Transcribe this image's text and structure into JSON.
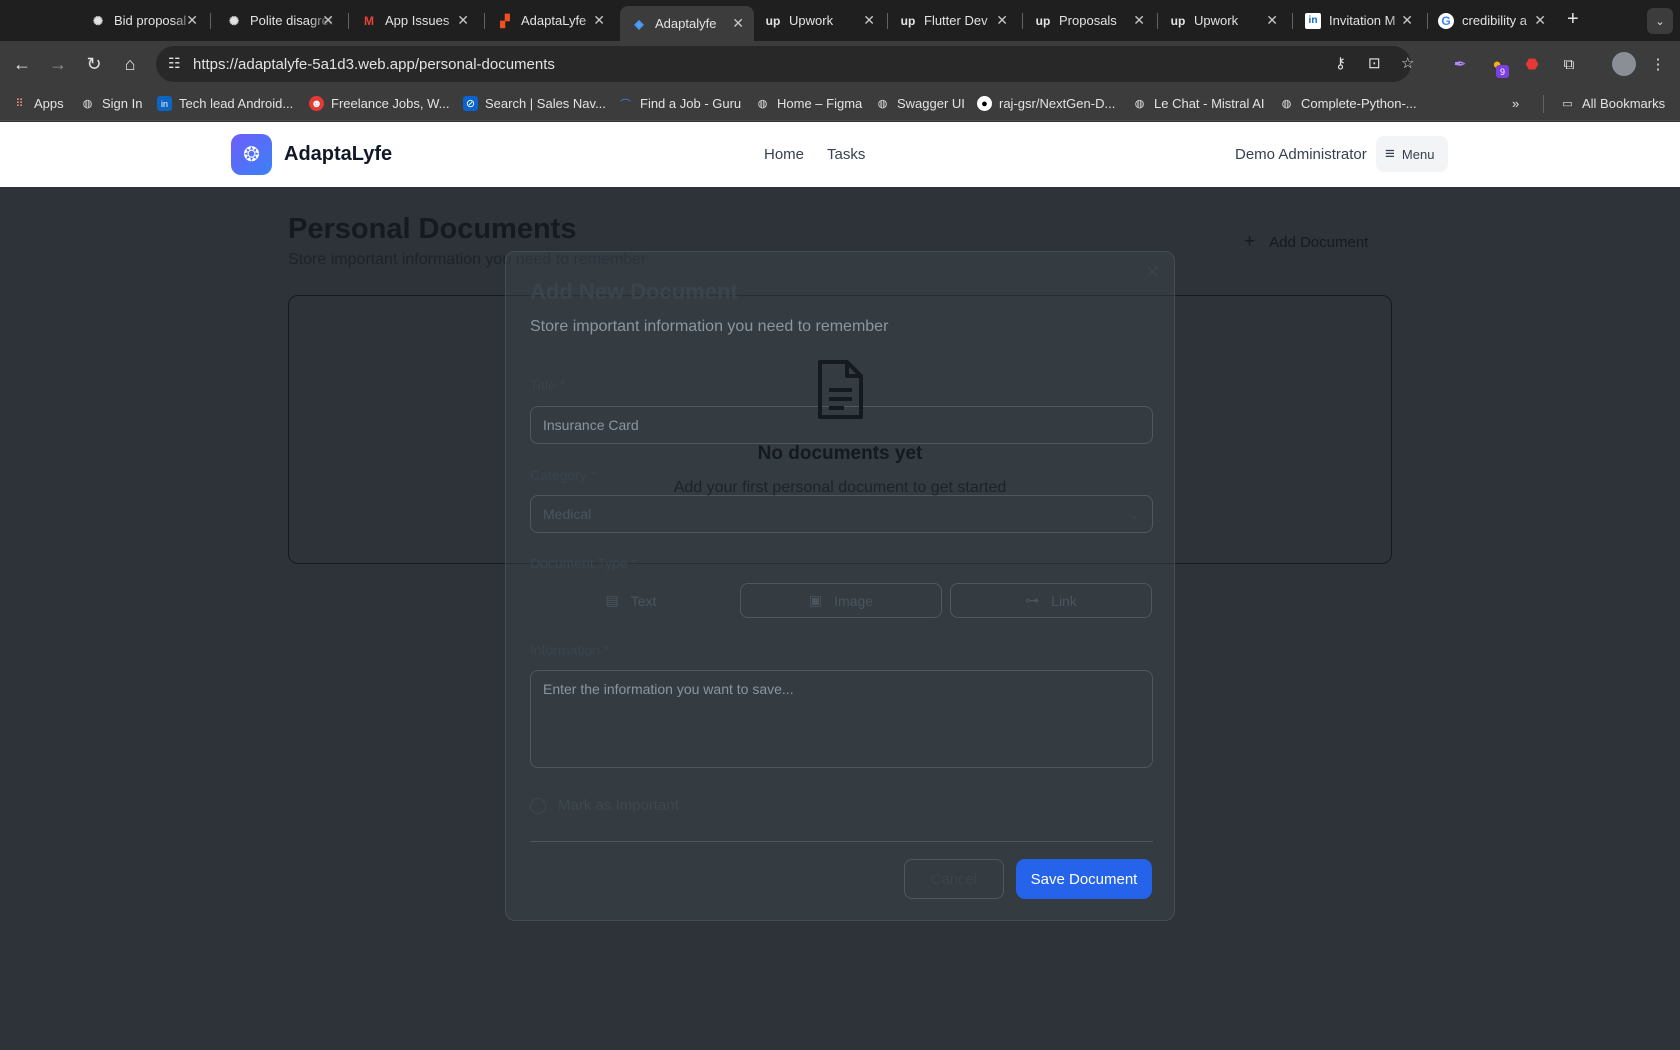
{
  "browser": {
    "tabs": [
      {
        "title": "Bid proposal",
        "icon": "chatgpt-icon",
        "active": false
      },
      {
        "title": "Polite disagreement",
        "icon": "chatgpt-icon",
        "active": false
      },
      {
        "title": "App Issues",
        "icon": "gmail-icon",
        "active": false
      },
      {
        "title": "AdaptaLyfe",
        "icon": "figma-icon",
        "active": false
      },
      {
        "title": "Adaptalyfe",
        "icon": "app-icon",
        "active": true
      },
      {
        "title": "Upwork",
        "icon": "upwork-icon",
        "active": false
      },
      {
        "title": "Flutter Dev",
        "icon": "upwork-icon",
        "active": false
      },
      {
        "title": "Proposals",
        "icon": "upwork-icon",
        "active": false
      },
      {
        "title": "Upwork",
        "icon": "upwork-icon",
        "active": false
      },
      {
        "title": "Invitation M",
        "icon": "linkedin-icon",
        "active": false
      },
      {
        "title": "credibility a",
        "icon": "google-icon",
        "active": false
      }
    ],
    "url": "https://adaptalyfe-5a1d3.web.app/personal-documents",
    "extension_badge": "9",
    "bookmarks": [
      {
        "label": "Apps",
        "icon": "apps-grid-icon"
      },
      {
        "label": "Sign In",
        "icon": "globe-icon"
      },
      {
        "label": "Tech lead Android...",
        "icon": "linkedin-icon"
      },
      {
        "label": "Freelance Jobs, W...",
        "icon": "freelancer-icon"
      },
      {
        "label": "Search | Sales Nav...",
        "icon": "sales-nav-icon"
      },
      {
        "label": "Find a Job - Guru",
        "icon": "guru-icon"
      },
      {
        "label": "Home – Figma",
        "icon": "globe-icon"
      },
      {
        "label": "Swagger UI",
        "icon": "globe-icon"
      },
      {
        "label": "raj-gsr/NextGen-D...",
        "icon": "github-icon"
      },
      {
        "label": "Le Chat - Mistral AI",
        "icon": "globe-icon"
      },
      {
        "label": "Complete-Python-...",
        "icon": "globe-icon"
      }
    ],
    "all_bookmarks": "All Bookmarks"
  },
  "header": {
    "brand": "AdaptaLyfe",
    "nav": [
      "Home",
      "Tasks"
    ],
    "user": "Demo Administrator",
    "menu_label": "Menu"
  },
  "page": {
    "title": "Personal Documents",
    "subtitle": "Store important information you need to remember",
    "add_button": "Add Document",
    "empty_title": "No documents yet",
    "empty_subtitle": "Add your first personal document to get started"
  },
  "modal": {
    "title": "Add New Document",
    "subtitle": "Store important information you need to remember",
    "title_label": "Title *",
    "title_value": "Insurance Card",
    "category_label": "Category *",
    "category_value": "Medical",
    "type_label": "Document Type *",
    "types": [
      "Text",
      "Image",
      "Link"
    ],
    "selected_type": "Text",
    "info_label": "Information *",
    "info_placeholder": "Enter the information you want to save...",
    "important_label": "Mark as Important",
    "cancel": "Cancel",
    "save": "Save Document"
  },
  "colors": {
    "primary": "#2563eb",
    "logo_gradient_start": "#6d5dfc",
    "logo_gradient_end": "#3b82f6",
    "overlay": "#2d3338"
  }
}
